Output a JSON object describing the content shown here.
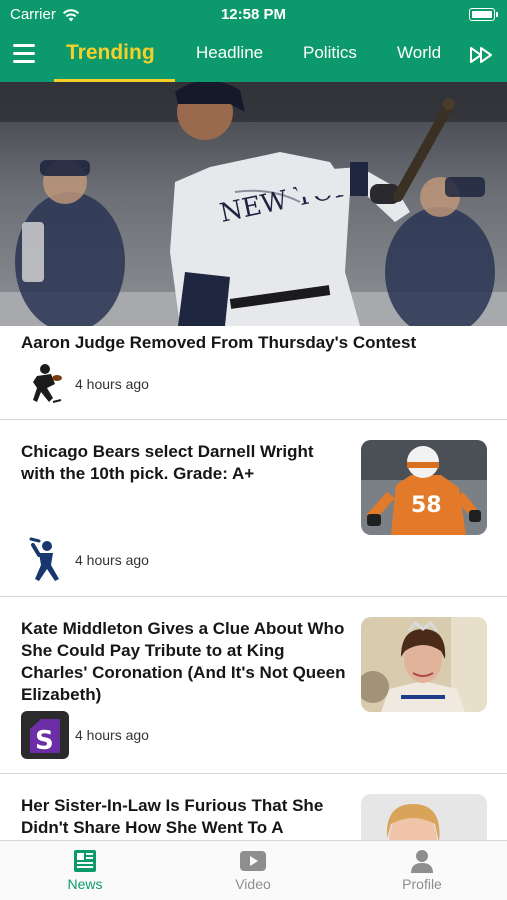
{
  "status_bar": {
    "carrier": "Carrier",
    "time": "12:58 PM"
  },
  "nav": {
    "tabs": [
      {
        "label": "Trending",
        "active": true
      },
      {
        "label": "Headline"
      },
      {
        "label": "Politics"
      },
      {
        "label": "World"
      }
    ]
  },
  "articles": [
    {
      "title": "Aaron Judge Removed From Thursday's Contest",
      "time": "4 hours ago",
      "source_icon": "football-player-icon"
    },
    {
      "title": "Chicago Bears select Darnell Wright with the 10th pick. Grade: A+",
      "time": "4 hours ago",
      "source_icon": "baseball-player-icon"
    },
    {
      "title": "Kate Middleton Gives a Clue About Who She Could Pay Tribute to at King Charles' Coronation (And It's Not Queen Elizabeth)",
      "time": "4 hours ago",
      "source_icon": "s-logo-icon"
    },
    {
      "title": "Her Sister-In-Law Is Furious That She Didn't Share How She Went To A",
      "time": "",
      "source_icon": ""
    }
  ],
  "tab_bar": {
    "news": "News",
    "video": "Video",
    "profile": "Profile"
  },
  "colors": {
    "brand_green": "#0c9a6c",
    "active_tab": "#f5d02a"
  }
}
